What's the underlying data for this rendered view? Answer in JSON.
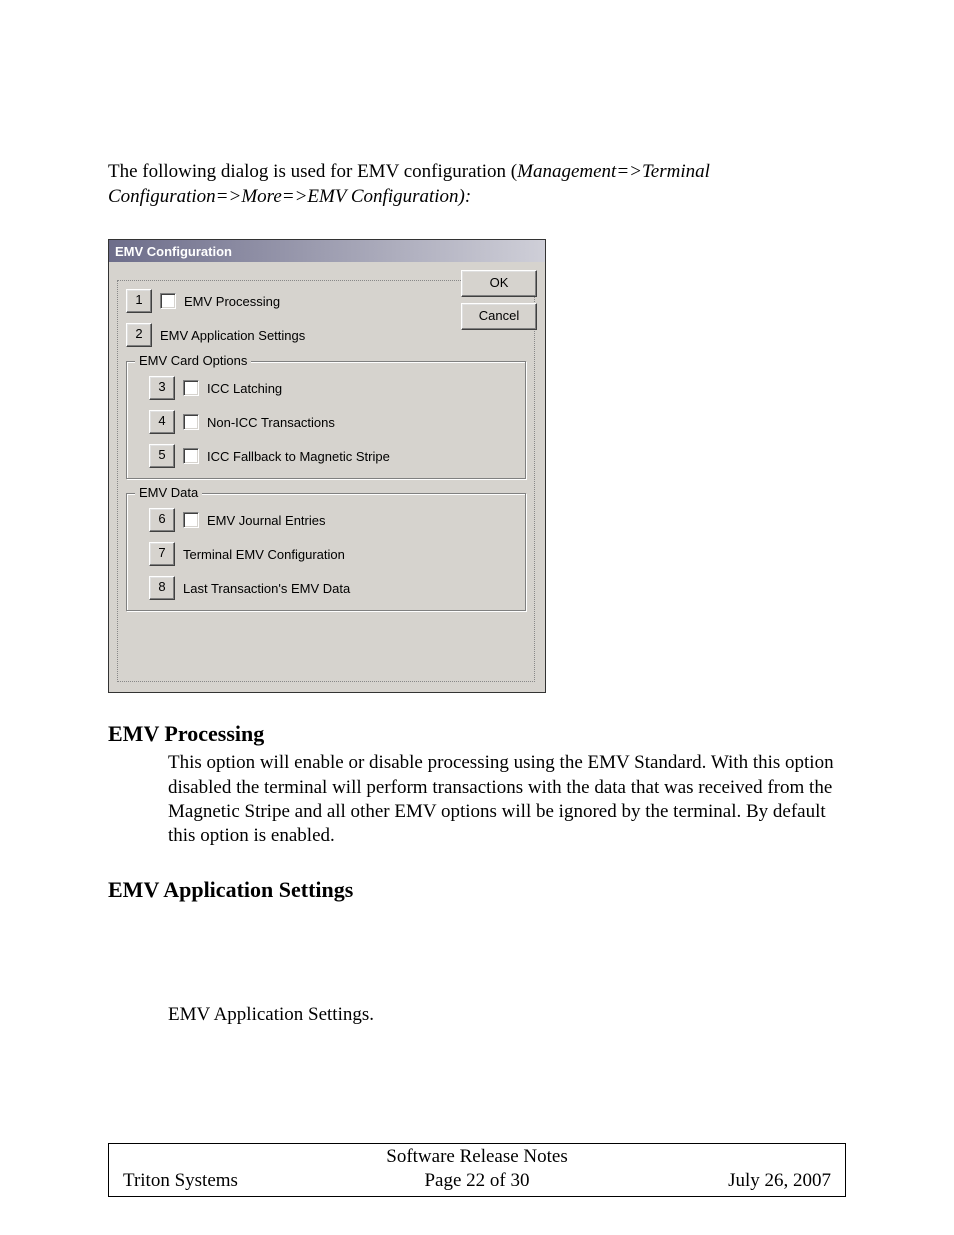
{
  "intro": {
    "prefix": "The following dialog is used for EMV configuration (",
    "nav_path": "Management=>Terminal Configuration=>More=>EMV Configuration):"
  },
  "dialog": {
    "title": "EMV Configuration",
    "ok": "OK",
    "cancel": "Cancel",
    "top_items": [
      {
        "num": "1",
        "has_check": true,
        "label": "EMV Processing"
      },
      {
        "num": "2",
        "has_check": false,
        "label": "EMV Application Settings"
      }
    ],
    "card_options": {
      "legend": "EMV Card Options",
      "items": [
        {
          "num": "3",
          "has_check": true,
          "label": "ICC Latching"
        },
        {
          "num": "4",
          "has_check": true,
          "label": "Non-ICC Transactions"
        },
        {
          "num": "5",
          "has_check": true,
          "label": "ICC Fallback to Magnetic Stripe"
        }
      ]
    },
    "emv_data": {
      "legend": "EMV Data",
      "items": [
        {
          "num": "6",
          "has_check": true,
          "label": "EMV Journal Entries"
        },
        {
          "num": "7",
          "has_check": false,
          "label": "Terminal EMV Configuration"
        },
        {
          "num": "8",
          "has_check": false,
          "label": "Last Transaction's EMV Data"
        }
      ]
    }
  },
  "sections": {
    "processing": {
      "heading": "EMV Processing",
      "body": "This option will enable or disable processing using the EMV Standard.  With this option disabled the terminal will perform transactions with the data that was received from the Magnetic Stripe and all other EMV options will be ignored by the terminal.  By default this option is enabled."
    },
    "app_settings": {
      "heading": "EMV Application Settings",
      "body": "EMV Application Settings."
    }
  },
  "footer": {
    "title": "Software Release Notes",
    "left": "Triton Systems",
    "mid": "Page 22 of 30",
    "right": "July 26, 2007"
  }
}
